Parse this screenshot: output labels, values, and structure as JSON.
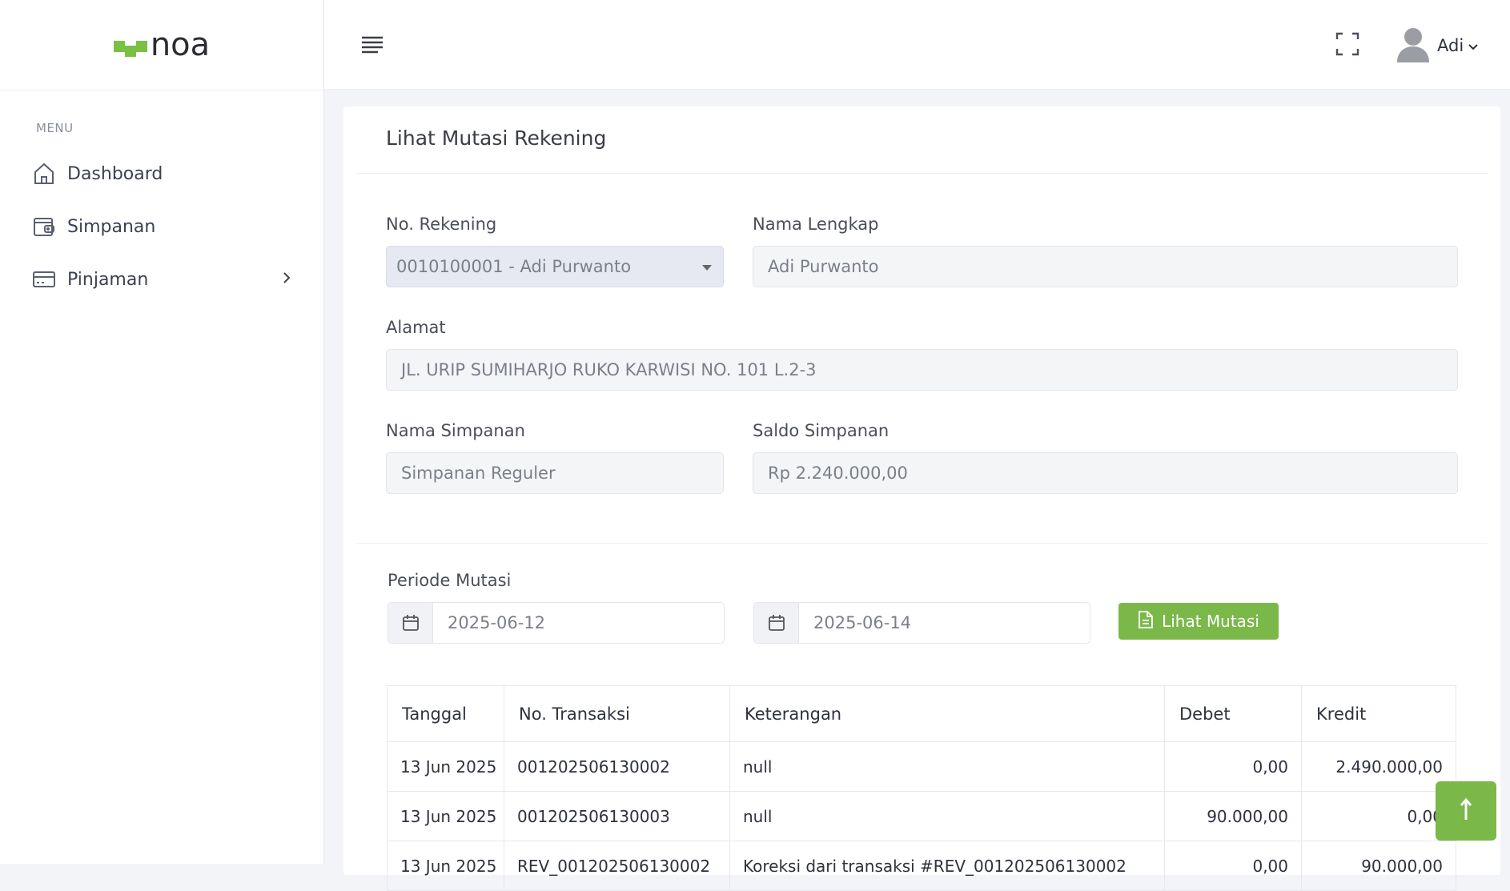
{
  "brand": {
    "name": "noa",
    "accent": "#7ac143"
  },
  "sidebar": {
    "menu_heading": "MENU",
    "items": [
      {
        "label": "Dashboard",
        "icon": "home-icon"
      },
      {
        "label": "Simpanan",
        "icon": "wallet-icon"
      },
      {
        "label": "Pinjaman",
        "icon": "credit-card-icon",
        "has_submenu": true
      }
    ]
  },
  "topbar": {
    "user_name": "Adi"
  },
  "page": {
    "title": "Lihat Mutasi Rekening",
    "form": {
      "no_rekening_label": "No. Rekening",
      "no_rekening_value": "0010100001 - Adi Purwanto",
      "nama_lengkap_label": "Nama Lengkap",
      "nama_lengkap_value": "Adi Purwanto",
      "alamat_label": "Alamat",
      "alamat_value": "JL. URIP SUMIHARJO RUKO KARWISI NO. 101 L.2-3",
      "nama_simpanan_label": "Nama Simpanan",
      "nama_simpanan_value": "Simpanan Reguler",
      "saldo_label": "Saldo Simpanan",
      "saldo_value": "Rp 2.240.000,00"
    },
    "periode": {
      "label": "Periode Mutasi",
      "start_date": "2025-06-12",
      "end_date": "2025-06-14",
      "button_label": "Lihat Mutasi"
    },
    "table": {
      "headers": [
        "Tanggal",
        "No. Transaksi",
        "Keterangan",
        "Debet",
        "Kredit"
      ],
      "rows": [
        [
          "13 Jun 2025",
          "001202506130002",
          "null",
          "0,00",
          "2.490.000,00"
        ],
        [
          "13 Jun 2025",
          "001202506130003",
          "null",
          "90.000,00",
          "0,00"
        ],
        [
          "13 Jun 2025",
          "REV_001202506130002",
          "Koreksi dari transaksi #REV_001202506130002",
          "0,00",
          "90.000,00"
        ]
      ]
    }
  }
}
